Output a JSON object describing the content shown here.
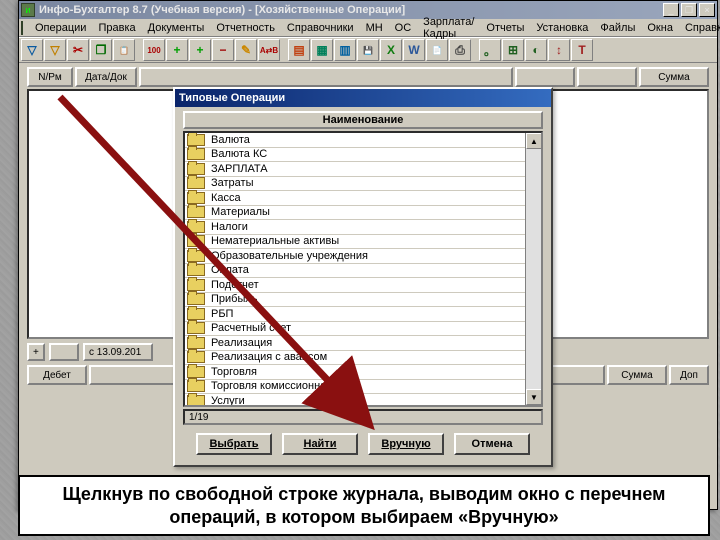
{
  "app": {
    "title": "Инфо-Бухгалтер 8.7 (Учебная версия) - [Хозяйственные Операции]"
  },
  "menu": [
    "Операции",
    "Правка",
    "Документы",
    "Отчетность",
    "Справочники",
    "МН",
    "ОС",
    "Зарплата/Кадры",
    "Отчеты",
    "Установка",
    "Файлы",
    "Окна",
    "Справка"
  ],
  "toolbar_icons": [
    {
      "n": "filter1-icon",
      "g": "▽",
      "c": "#0a5aa0"
    },
    {
      "n": "filter2-icon",
      "g": "▽",
      "c": "#c08000"
    },
    {
      "n": "scissors-icon",
      "g": "✂",
      "c": "#a00"
    },
    {
      "n": "copy-icon",
      "g": "❐",
      "c": "#006a00"
    },
    {
      "n": "paste-icon",
      "g": "📋",
      "c": "#806020"
    },
    {
      "n": "SEP"
    },
    {
      "n": "add100-icon",
      "g": "100",
      "c": "#a00"
    },
    {
      "n": "plus-icon",
      "g": "+",
      "c": "#00a000"
    },
    {
      "n": "plusfile-icon",
      "g": "+",
      "c": "#00a000"
    },
    {
      "n": "minus-icon",
      "g": "−",
      "c": "#a00000"
    },
    {
      "n": "pencil-icon",
      "g": "✎",
      "c": "#cc8800"
    },
    {
      "n": "abv-icon",
      "g": "А⇄В",
      "c": "#a00"
    },
    {
      "n": "SEP"
    },
    {
      "n": "doc-icon",
      "g": "▤",
      "c": "#c04010"
    },
    {
      "n": "calc-icon",
      "g": "▦",
      "c": "#00805a"
    },
    {
      "n": "book-icon",
      "g": "▥",
      "c": "#0060a0"
    },
    {
      "n": "save-icon",
      "g": "💾",
      "c": "#0050c0"
    },
    {
      "n": "excel-icon",
      "g": "X",
      "c": "#107c10"
    },
    {
      "n": "word-icon",
      "g": "W",
      "c": "#2b579a"
    },
    {
      "n": "note-icon",
      "g": "📄",
      "c": "#806020"
    },
    {
      "n": "print-icon",
      "g": "⎙",
      "c": "#404040"
    },
    {
      "n": "SEP"
    },
    {
      "n": "tool1-icon",
      "g": "。",
      "c": "#206020"
    },
    {
      "n": "tool2-icon",
      "g": "⊞",
      "c": "#206020"
    },
    {
      "n": "tool3-icon",
      "g": "◐",
      "c": "#206020"
    },
    {
      "n": "ruler-icon",
      "g": "↕",
      "c": "#a02020"
    },
    {
      "n": "hammer-icon",
      "g": "T",
      "c": "#a02020"
    }
  ],
  "journal": {
    "head": {
      "col1": "N/Рм",
      "col2": "Дата/Док",
      "col_sum": "Сумма"
    },
    "footer": {
      "plus": "+",
      "date": "с 13.09.201"
    },
    "row2": {
      "debit": "Дебет",
      "summa": "Сумма",
      "dop": "Доп"
    }
  },
  "dialog": {
    "title": "Типовые Операции",
    "col_header": "Наименование",
    "items": [
      "Валюта",
      "Валюта КС",
      "ЗАРПЛАТА",
      "Затраты",
      "Касса",
      "Материалы",
      "Налоги",
      "Нематериальные активы",
      "Образовательные учреждения",
      "Оплата",
      "Подотчет",
      "Прибыль",
      "РБП",
      "Расчетный счет",
      "Реализация",
      "Реализация с авансом",
      "Торговля",
      "Торговля комиссионная",
      "Услуги"
    ],
    "status": "1/19",
    "buttons": {
      "select": "Выбрать",
      "find": "Найти",
      "manual": "Вручную",
      "cancel": "Отмена"
    }
  },
  "caption": "Щелкнув по свободной строке журнала, выводим окно с перечнем операций, в котором выбираем «Вручную»"
}
